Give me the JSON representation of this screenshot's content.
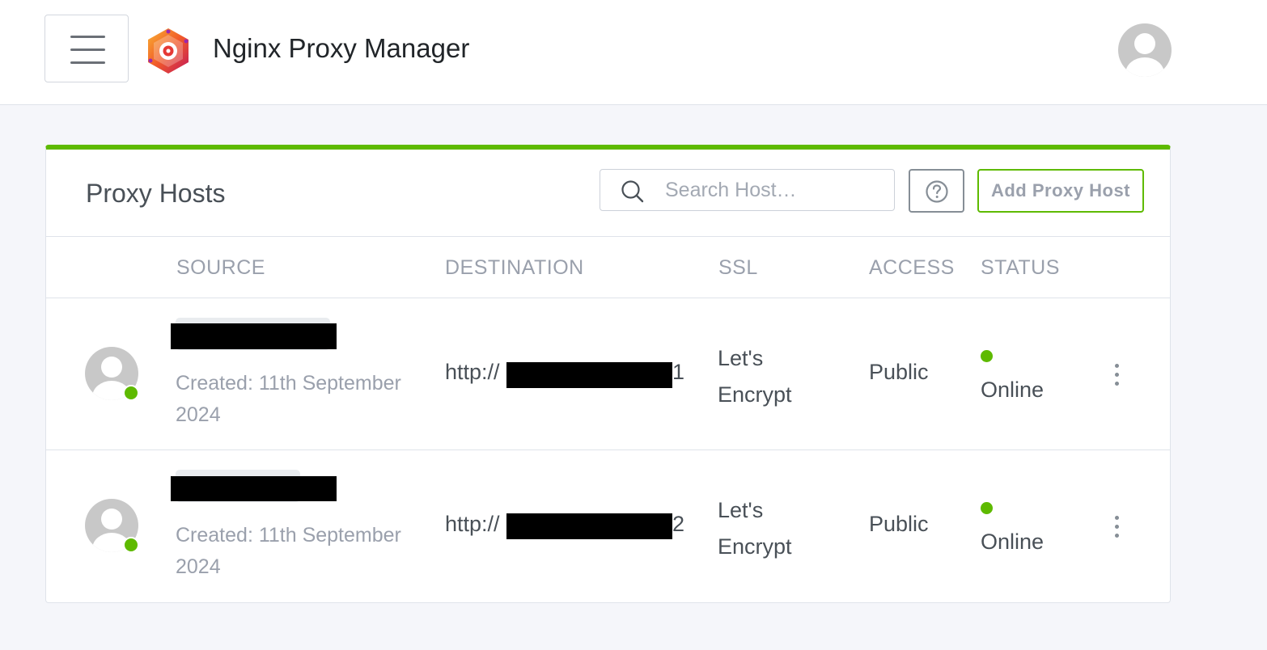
{
  "header": {
    "app_title": "Nginx Proxy Manager",
    "menu_icon": "hamburger-menu-icon",
    "logo_icon": "nginx-proxy-manager-logo",
    "user_icon": "user-avatar-icon"
  },
  "card": {
    "title": "Proxy Hosts",
    "accent_color": "#5eba00",
    "search": {
      "placeholder": "Search Host…",
      "value": ""
    },
    "help_icon": "question-circle-icon",
    "add_button_label": "Add Proxy Host"
  },
  "table": {
    "columns": {
      "source": "SOURCE",
      "destination": "DESTINATION",
      "ssl": "SSL",
      "access": "ACCESS",
      "status": "STATUS"
    },
    "rows": [
      {
        "created": "Created: 11th September 2024",
        "destination_prefix": "http://",
        "destination_suffix": "1",
        "ssl": "Let's Encrypt",
        "access": "Public",
        "status": "Online",
        "status_color": "#5eba00"
      },
      {
        "created": "Created: 11th September 2024",
        "destination_prefix": "http://",
        "destination_suffix": "2",
        "ssl": "Let's Encrypt",
        "access": "Public",
        "status": "Online",
        "status_color": "#5eba00"
      }
    ]
  }
}
